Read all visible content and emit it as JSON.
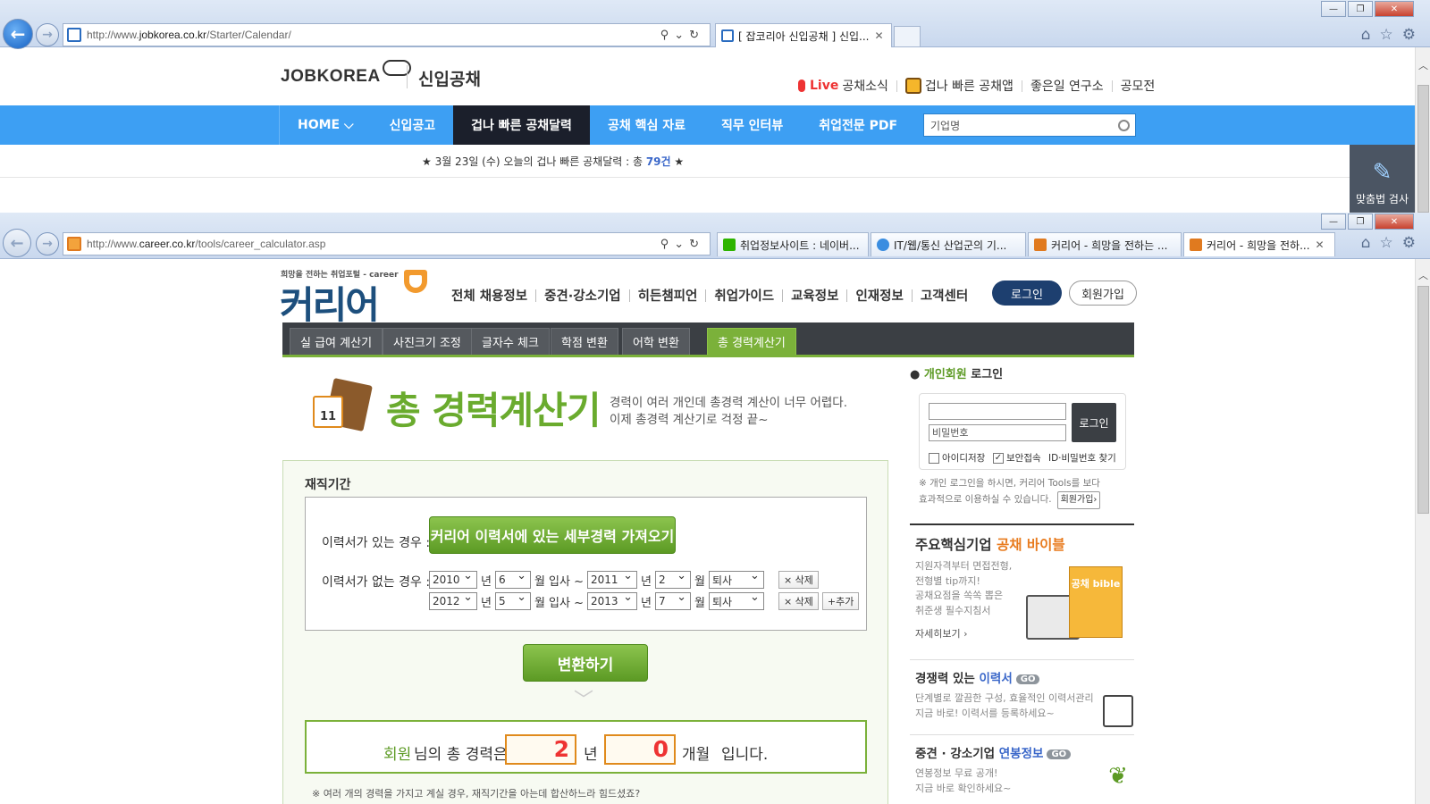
{
  "win1": {
    "url_prefix": "http://www.",
    "url_domain": "jobkorea.co.kr",
    "url_path": "/Starter/Calendar/",
    "tab_title": "[ 잡코리아 신입공채 ] 신입...",
    "page": {
      "logo_text": "JOBKOREA",
      "logo_sub": "신입공채",
      "top_links": {
        "live": "Live",
        "live_rest": "공채소식",
        "app": "겁나 빠른 공채앱",
        "lab": "좋은일 연구소",
        "contest": "공모전"
      },
      "nav": [
        "HOME ⌵",
        "신입공고",
        "겁나 빠른 공채달력",
        "공채 핵심 자료",
        "직무 인터뷰",
        "취업전문 PDF"
      ],
      "search_placeholder": "기업명",
      "notice_pre": "★ 3월 23일 (수) 오늘의 겁나 빠른 공채달력 : 총 ",
      "notice_num": "79건",
      "notice_post": " ★",
      "spell_label": "맞춤법 검사"
    }
  },
  "win2": {
    "url_prefix": "http://www.",
    "url_domain": "career.co.kr",
    "url_path": "/tools/career_calculator.asp",
    "tabs": [
      {
        "title": "취업정보사이트 : 네이버...",
        "icon_color": "#2db400"
      },
      {
        "title": "IT/웹/통신 산업군의 기...",
        "icon_color": "#3a8de0"
      },
      {
        "title": "커리어 - 희망을 전하는 ...",
        "icon_color": "#e07a1f"
      },
      {
        "title": "커리어 - 희망을 전하...",
        "icon_color": "#e07a1f"
      }
    ],
    "page": {
      "tagline": "희망을 전하는 취업포털 - career",
      "logo_text": "커리어",
      "menu": [
        "전체 채용정보",
        "중견·강소기업",
        "히든챔피언",
        "취업가이드",
        "교육정보",
        "인재정보",
        "고객센터"
      ],
      "login_btn": "로그인",
      "join_btn": "회원가입",
      "tool_tabs": [
        "실 급여 계산기",
        "사진크기 조정",
        "글자수 체크",
        "학점 변환",
        "어학 변환",
        "총 경력계산기"
      ],
      "calc_icon_num": "11",
      "title": "총 경력계산기",
      "desc_line1": "경력이 여러 개인데 총경력 계산이 너무 어렵다.",
      "desc_line2": "이제 총경력 계산기로 걱정 끝~",
      "section_label": "재직기간",
      "has_resume_label": "이력서가 있는 경우 :",
      "import_btn": "커리어 이력서에 있는 세부경력 가져오기",
      "no_resume_label": "이력서가 없는 경우 :",
      "rows": [
        {
          "y1": "2010",
          "m1": "6",
          "y2": "2011",
          "m2": "2",
          "status": "퇴사",
          "buttons": [
            "× 삭제"
          ]
        },
        {
          "y1": "2012",
          "m1": "5",
          "y2": "2013",
          "m2": "7",
          "status": "퇴사",
          "buttons": [
            "× 삭제",
            "+추가"
          ]
        }
      ],
      "unit_year": "년",
      "unit_month_join": "월 입사 ~",
      "unit_month": "월",
      "convert_btn": "변환하기",
      "result_member": "회원",
      "result_pre": "님의 총 경력은",
      "result_years": "2",
      "result_year_unit": "년",
      "result_months": "0",
      "result_month_unit": "개월",
      "result_post": "입니다.",
      "note": "※ 여러 개의 경력을 가지고 계실 경우, 재직기간을 아는데 합산하느라 힘드셨죠?",
      "sidebar": {
        "login_hd_a": "개인회원",
        "login_hd_b": " 로그인",
        "pw_placeholder": "비밀번호",
        "login_btn": "로그인",
        "save_id": "아이디저장",
        "secure": "보안접속",
        "find": "ID·비밀번호 찾기",
        "help1": "※ 개인 로그인을 하시면, 커리어 Tools를 보다",
        "help2": "효과적으로 이용하실 수 있습니다.",
        "join_small": "회원가입›",
        "p1_a": "주요핵심기업 ",
        "p1_b": "공채 바이블",
        "p1_desc": [
          "지원자격부터 면접전형,",
          "전형별 tip까지!",
          "공채요점을 쏙쏙 뽑은",
          "취준생 필수지침서"
        ],
        "p1_more": "자세히보기 ›",
        "bible_label": "공채 bible",
        "p2_a": "경쟁력 있는 ",
        "p2_b": "이력서",
        "go": "GO",
        "p2_desc": [
          "단계별로 깔끔한 구성, 효율적인 이력서관리",
          "지금 바로! 이력서를 등록하세요~"
        ],
        "p3_a": "중견 · 강소기업 ",
        "p3_b": "연봉정보",
        "p3_desc": [
          "연봉정보 무료 공개!",
          "지금 바로 확인하세요~"
        ]
      }
    }
  },
  "colors": {
    "jk_blue": "#3d9ff3",
    "jk_dark": "#1b1f2b",
    "career_green": "#7bb13a",
    "career_navy": "#1d4f7d",
    "orange": "#e87b1e"
  }
}
